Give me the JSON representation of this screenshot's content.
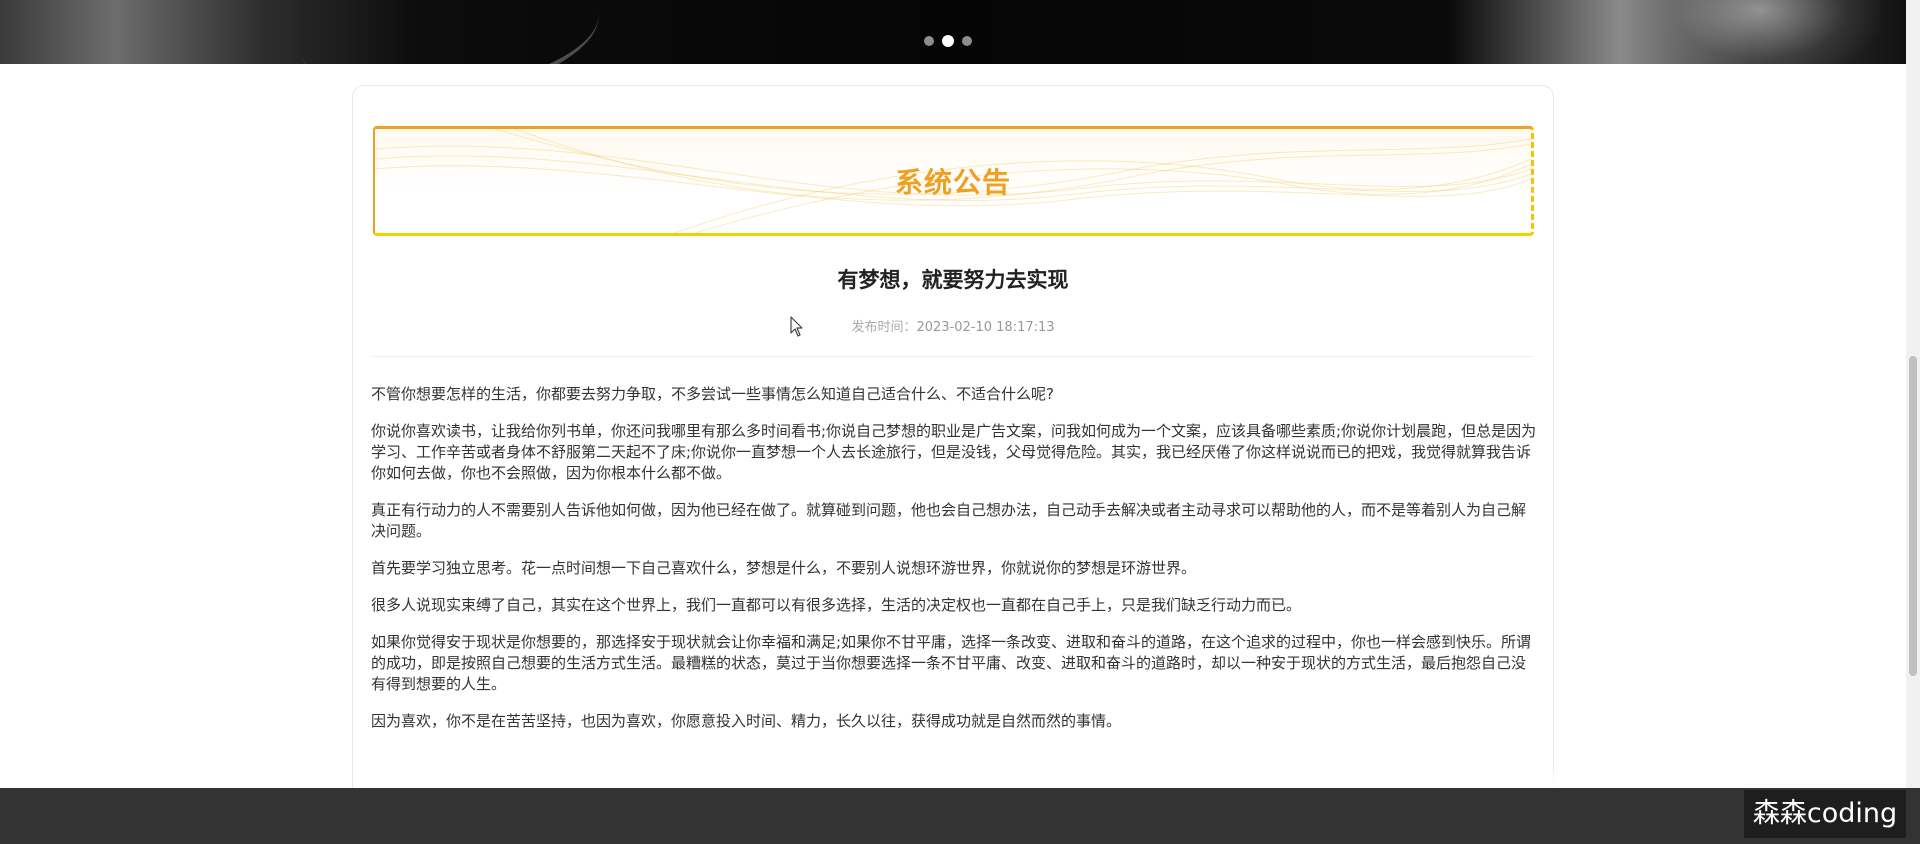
{
  "banner": {
    "carousel_dots": [
      {
        "active": false
      },
      {
        "active": true
      },
      {
        "active": false
      }
    ]
  },
  "notice": {
    "title": "系统公告",
    "accent_color": "#f0a020"
  },
  "article": {
    "title": "有梦想，就要努力去实现",
    "published_label": "发布时间：",
    "published_time": "2023-02-10 18:17:13",
    "paragraphs": [
      "不管你想要怎样的生活，你都要去努力争取，不多尝试一些事情怎么知道自己适合什么、不适合什么呢?",
      "你说你喜欢读书，让我给你列书单，你还问我哪里有那么多时间看书;你说自己梦想的职业是广告文案，问我如何成为一个文案，应该具备哪些素质;你说你计划晨跑，但总是因为学习、工作辛苦或者身体不舒服第二天起不了床;你说你一直梦想一个人去长途旅行，但是没钱，父母觉得危险。其实，我已经厌倦了你这样说说而已的把戏，我觉得就算我告诉你如何去做，你也不会照做，因为你根本什么都不做。",
      "真正有行动力的人不需要别人告诉他如何做，因为他已经在做了。就算碰到问题，他也会自己想办法，自己动手去解决或者主动寻求可以帮助他的人，而不是等着别人为自己解决问题。",
      "首先要学习独立思考。花一点时间想一下自己喜欢什么，梦想是什么，不要别人说想环游世界，你就说你的梦想是环游世界。",
      "很多人说现实束缚了自己，其实在这个世界上，我们一直都可以有很多选择，生活的决定权也一直都在自己手上，只是我们缺乏行动力而已。",
      "如果你觉得安于现状是你想要的，那选择安于现状就会让你幸福和满足;如果你不甘平庸，选择一条改变、进取和奋斗的道路，在这个追求的过程中，你也一样会感到快乐。所谓的成功，即是按照自己想要的生活方式生活。最糟糕的状态，莫过于当你想要选择一条不甘平庸、改变、进取和奋斗的道路时，却以一种安于现状的方式生活，最后抱怨自己没有得到想要的人生。",
      "因为喜欢，你不是在苦苦坚持，也因为喜欢，你愿意投入时间、精力，长久以往，获得成功就是自然而然的事情。"
    ]
  },
  "watermark": {
    "text": "森森coding"
  },
  "colors": {
    "footer": "#333333",
    "notice_border_top": "#f0a020",
    "notice_border_bottom": "#f5d000"
  }
}
